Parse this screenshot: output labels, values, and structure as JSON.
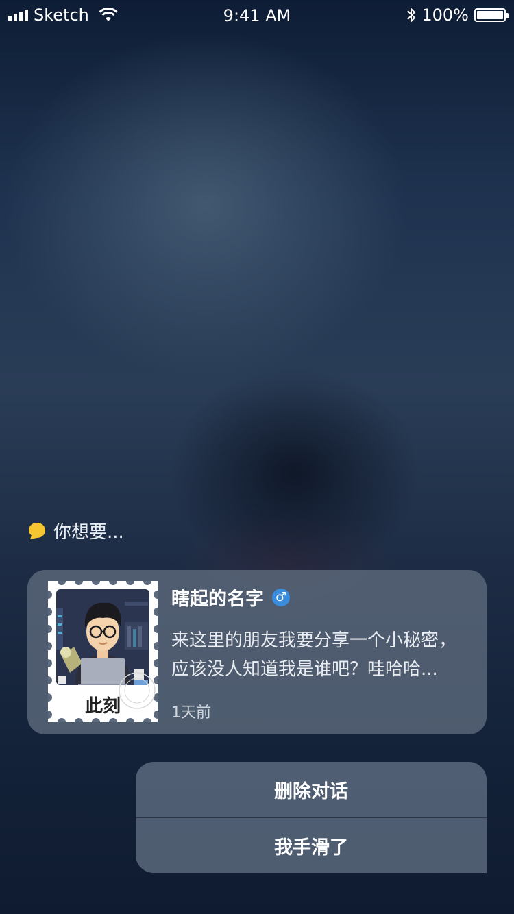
{
  "status_bar": {
    "carrier": "Sketch",
    "time": "9:41 AM",
    "battery": "100%",
    "battery_level": 1.0
  },
  "prompt": {
    "text": "你想要...",
    "icon": "speech-bubble-icon",
    "icon_color": "#f6c630"
  },
  "card": {
    "stamp_label": "此刻",
    "name": "瞎起的名字",
    "gender_symbol": "♂",
    "gender_color": "#3a8ddc",
    "message_line1": "来这里的朋友我要分享一个小秘密，",
    "message_line2": "应该没人知道我是谁吧？哇哈哈...",
    "time": "1天前"
  },
  "sheet": {
    "delete_label": "删除对话",
    "cancel_label": "我手滑了"
  }
}
